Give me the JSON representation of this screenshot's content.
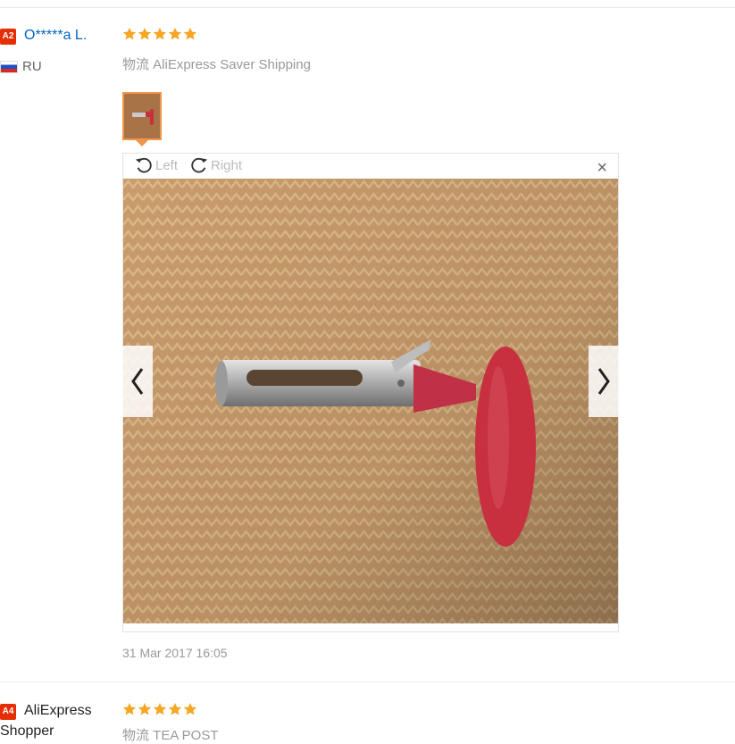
{
  "reviews": [
    {
      "badge": "A2",
      "name": "O*****a L.",
      "country": "RU",
      "rating": 5,
      "logistics": "物流 AliExpress Saver Shipping",
      "date": "31 Mar 2017 16:05"
    },
    {
      "badge": "A4",
      "name_line1": "AliExpress",
      "name_line2": "Shopper",
      "rating": 5,
      "logistics": "物流 TEA POST"
    }
  ],
  "viewer": {
    "rotate_left": "Left",
    "rotate_right": "Right",
    "close": "×"
  },
  "colors": {
    "star": "#f5a623",
    "badge": "#e62e04",
    "link": "#0066c0",
    "thumb_border": "#f0964b"
  },
  "icons": [
    "star-icon",
    "rotate-left-icon",
    "rotate-right-icon",
    "close-icon",
    "chevron-left-icon",
    "chevron-right-icon",
    "flag-icon"
  ]
}
